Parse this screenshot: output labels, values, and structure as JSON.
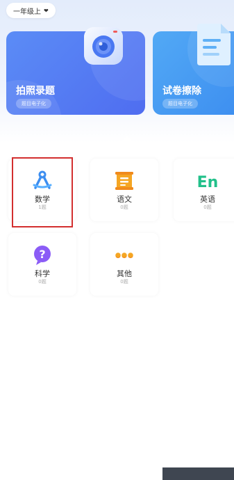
{
  "grade_selector": {
    "label": "一年级上"
  },
  "cards": [
    {
      "title": "拍照录题",
      "badge": "题目电子化",
      "icon": "camera-icon"
    },
    {
      "title": "试卷擦除",
      "badge": "题目电子化",
      "icon": "document-icon"
    }
  ],
  "subjects": [
    {
      "name": "数学",
      "count": "1题",
      "icon": "compass-icon",
      "color": "#3d8ef0"
    },
    {
      "name": "语文",
      "count": "0题",
      "icon": "book-icon",
      "color": "#f5a623"
    },
    {
      "name": "英语",
      "count": "0题",
      "icon": "en-icon",
      "color": "#22c08a"
    },
    {
      "name": "科学",
      "count": "0题",
      "icon": "question-icon",
      "color": "#8b5cf6"
    },
    {
      "name": "其他",
      "count": "0题",
      "icon": "dots-icon",
      "color": "#f5a623"
    }
  ],
  "en_glyph": "En",
  "question_glyph": "?"
}
